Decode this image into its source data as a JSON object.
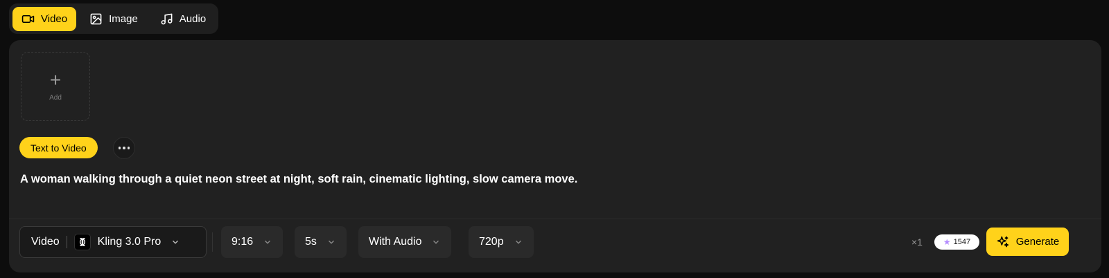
{
  "tabs": [
    {
      "label": "Video",
      "icon": "video-camera-icon",
      "active": true
    },
    {
      "label": "Image",
      "icon": "image-icon",
      "active": false
    },
    {
      "label": "Audio",
      "icon": "music-note-icon",
      "active": false
    }
  ],
  "upload": {
    "add_label": "Add",
    "icon": "plus-icon"
  },
  "mode": {
    "label": "Text to Video",
    "more_icon": "more-horizontal-icon"
  },
  "prompt": "A woman walking through a quiet neon street at night, soft rain, cinematic lighting, slow camera move.",
  "toolbar": {
    "model_type": "Video",
    "model_name": "Kling 3.0 Pro",
    "aspect_ratio": "9:16",
    "duration": "5s",
    "audio": "With Audio",
    "resolution": "720p",
    "count": "×1",
    "credits": "1547",
    "generate_label": "Generate"
  },
  "colors": {
    "accent": "#ffd21a",
    "panel": "#212121",
    "background": "#0d0d0d"
  }
}
